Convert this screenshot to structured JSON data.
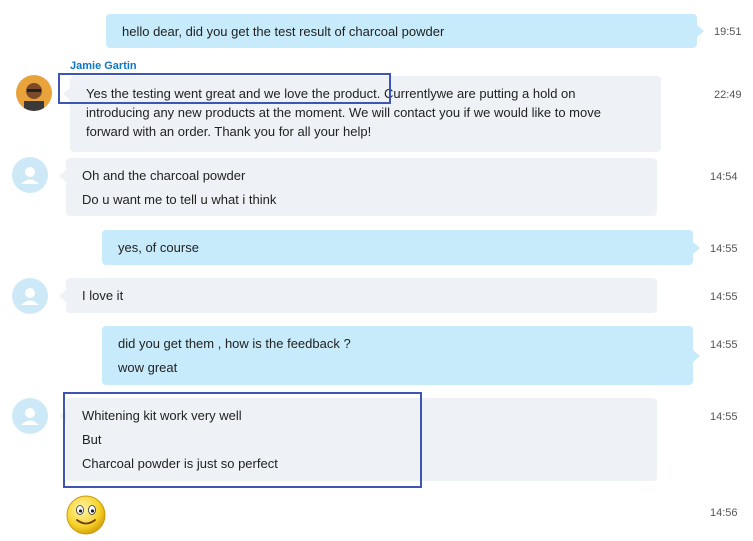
{
  "messages": {
    "m1": {
      "lines": [
        "hello dear, did you get the test result of charcoal powder"
      ],
      "time": "19:51"
    },
    "m2": {
      "sender": "Jamie Gartin",
      "lines": [
        "Yes the testing went great and we love the product. Currentlywe are putting a hold on",
        "introducing any new products at the moment. We will contact you if we would like to move",
        "forward with an order. Thank you for all your help!"
      ],
      "time": "22:49"
    },
    "m3": {
      "lines": [
        "Oh and the charcoal powder",
        "Do u want me to tell u what i think"
      ],
      "time": "14:54"
    },
    "m4": {
      "lines": [
        "yes, of course"
      ],
      "time": "14:55"
    },
    "m5": {
      "lines": [
        "I love it"
      ],
      "time": "14:55"
    },
    "m6": {
      "lines": [
        "did you get them , how is the feedback ?",
        "wow great"
      ],
      "time": "14:55"
    },
    "m7": {
      "lines": [
        "Whitening kit work very well",
        "But",
        "Charcoal powder is just so perfect"
      ],
      "time": "14:55"
    },
    "m8": {
      "time": "14:56"
    }
  },
  "icons": {
    "avatar": "user-silhouette-icon",
    "emoji": "smiley-face-icon",
    "photo": "contact-photo"
  }
}
